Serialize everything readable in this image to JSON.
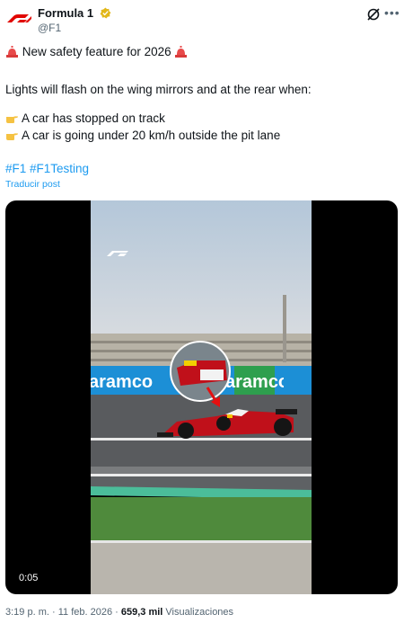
{
  "account": {
    "name": "Formula 1",
    "handle": "@F1",
    "verified": true,
    "brand_color": "#e10600"
  },
  "post": {
    "lines": [
      {
        "icon": "siren-emoji",
        "text": "New safety feature for 2026",
        "trail_icon": "siren-emoji"
      },
      {
        "text": "Lights will flash on the wing mirrors and at the rear when:"
      },
      {
        "icon": "pointing-hand-emoji",
        "text": "A car has stopped on track"
      },
      {
        "icon": "pointing-hand-emoji",
        "text": "A car is going under 20 km/h outside the pit lane"
      }
    ],
    "hashtags": "#F1 #F1Testing",
    "translate_label": "Traducir post"
  },
  "media": {
    "timecode": "0:05",
    "banner_text": "aramco"
  },
  "footer": {
    "time": "3:19 p. m.",
    "date": "11 feb. 2026",
    "views_count": "659,3 mil",
    "views_label": "Visualizaciones"
  },
  "colors": {
    "link": "#1d9bf0",
    "secondary_text": "#536471",
    "verified_badge": "#e2b719"
  }
}
